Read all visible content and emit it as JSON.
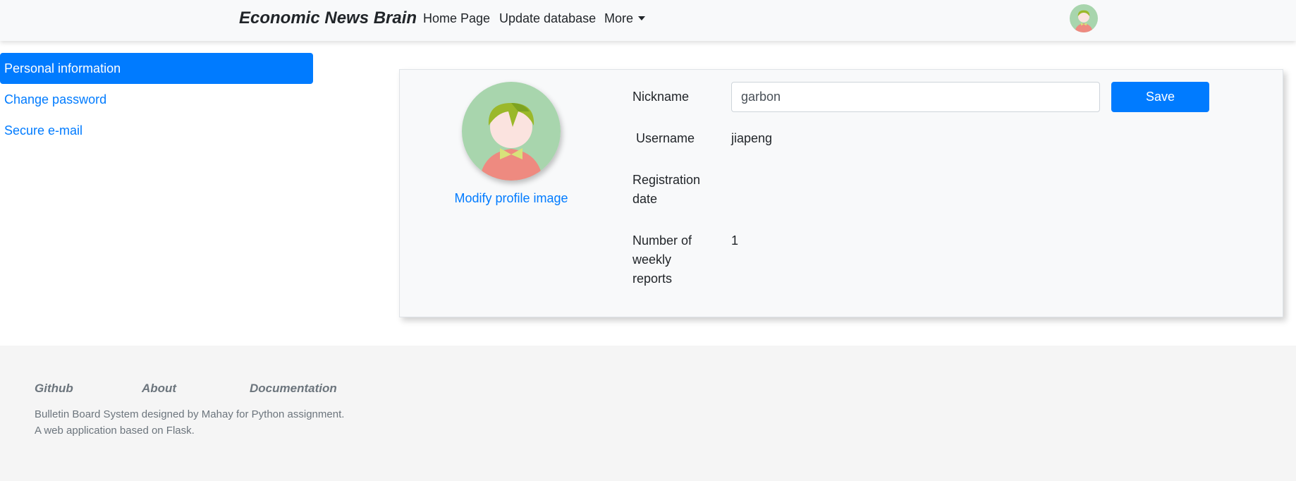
{
  "navbar": {
    "brand": "Economic News Brain",
    "links": {
      "home": "Home Page",
      "update": "Update database",
      "more": "More"
    }
  },
  "sidebar": {
    "items": [
      {
        "label": "Personal information",
        "active": true
      },
      {
        "label": "Change password",
        "active": false
      },
      {
        "label": "Secure e-mail",
        "active": false
      }
    ]
  },
  "profile": {
    "modify_image_label": "Modify profile image",
    "nickname_label": "Nickname",
    "nickname_value": "garbon",
    "save_label": "Save",
    "username_label": "Username",
    "username_value": "jiapeng",
    "registration_label": "Registration date",
    "registration_value": "",
    "weekly_label": "Number of weekly reports",
    "weekly_value": "1"
  },
  "footer": {
    "links": {
      "github": "Github",
      "about": "About",
      "docs": "Documentation"
    },
    "line1": "Bulletin Board System designed by Mahay for Python assignment.",
    "line2": "A web application based on Flask."
  },
  "colors": {
    "accent": "#007bff",
    "avatar_bg": "#a8d5ad",
    "hair": "#9bb82a",
    "face": "#fbe3df",
    "shirt": "#ee8a80",
    "bowtie": "#d8e27a"
  }
}
